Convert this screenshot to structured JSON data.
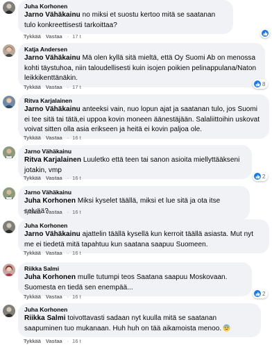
{
  "colors": {
    "bubble": "#f0f2f5",
    "meta": "#65676b",
    "like": "#1877f2"
  },
  "comments": [
    {
      "author": "Juha Korhonen",
      "mention": "Jarno Vähäkainu",
      "text": " no miksi et suostu kertoo mitä se saatanan tulo konkreettisesti tarkoittaa?",
      "like": "Tykkää",
      "reply": "Vastaa",
      "time": "17 t",
      "reactions": "",
      "reaction_icon": "like-icon"
    },
    {
      "author": "Katja Andersen",
      "mention": "Jarno Vähäkainu",
      "text": " Mä olen kyllä sitä mieltä, että Oy Suomi Ab on menossa kohti täystuhoa, niin taloudellisesti kuin isojen poikien pelinappulana/Naton leikkikenttänäkin.",
      "like": "Tykkää",
      "reply": "Vastaa",
      "time": "17 t",
      "reactions": "8",
      "reaction_icon": "like-icon"
    },
    {
      "author": "Ritva Karjalainen",
      "mention": "Jarno Vähäkainu",
      "text": " anteeksi vain, nuo lopun ajat ja saatanan tulo, jos Suomi ei tee sitä tai tätä,ei uppoa kovin moneen äänestäjään. Salaliittoihin uskovat voivat sitten olla asia erikseen ja heitä ei kovin paljoa ole.",
      "like": "Tykkää",
      "reply": "Vastaa",
      "time": "16 t",
      "reactions": "",
      "reaction_icon": ""
    },
    {
      "author": "Jarno Vähäkainu",
      "mention": "Ritva Karjalainen",
      "text": " Luuletko että teen tai sanon asioita miellyttääkseni jotakin, vmp",
      "like": "Tykkää",
      "reply": "Vastaa",
      "time": "16 t",
      "reactions": "2",
      "reaction_icon": "like-icon"
    },
    {
      "author": "Jarno Vähäkainu",
      "mention": "Juha Korhonen",
      "text": " Miksi kyselet täällä, miksi et lue sitä ja ota itse selvää?",
      "like": "Tykkää",
      "reply": "Vastaa",
      "time": "16 t",
      "reactions": "",
      "reaction_icon": ""
    },
    {
      "author": "Juha Korhonen",
      "mention": "Jarno Vähäkainu",
      "text": " ajattelin täällä kysellä kun kerroit täällä asiasta. Mut nyt me ei tiedetä mitä tapahtuu kun saatana saapuu Suomeen.",
      "like": "Tykkää",
      "reply": "Vastaa",
      "time": "16 t",
      "reactions": "",
      "reaction_icon": ""
    },
    {
      "author": "Riikka Salmi",
      "mention": "Juha Korhonen",
      "text": " mulle tutumpi teos Saatana saapuu Moskovaan. Suomesta en tiedä sen enempää...",
      "like": "Tykkää",
      "reply": "Vastaa",
      "time": "16 t",
      "reactions": "2",
      "reaction_icon": "like-icon"
    },
    {
      "author": "Juha Korhonen",
      "mention": "Riikka Salmi",
      "text": " toivottavasti sadaan nyt kuulla mitä se saatanan saapuminen tuo mukanaan. Huh huh on tää aikamoista menoo.",
      "like": "Tykkää",
      "reply": "Vastaa",
      "time": "16 t",
      "reactions": "",
      "reaction_icon": "",
      "emoji": "cold-sweat-face"
    }
  ]
}
